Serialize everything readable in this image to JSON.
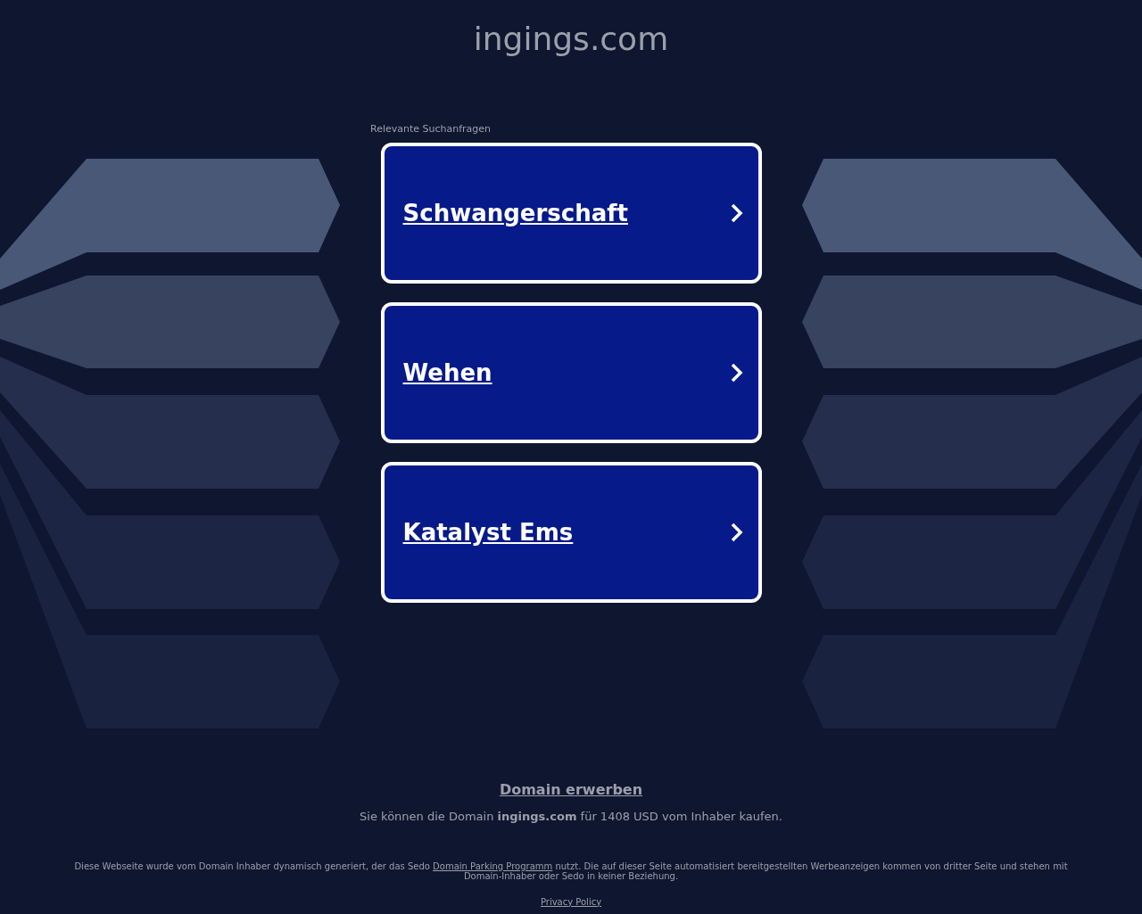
{
  "site_title": "ingings.com",
  "related_label": "Relevante Suchanfragen",
  "links": [
    {
      "label": "Schwangerschaft"
    },
    {
      "label": "Wehen"
    },
    {
      "label": "Katalyst Ems"
    }
  ],
  "buy_link": "Domain erwerben",
  "buy_text": "Sie können die Domain **ingings.com** für 1408 USD vom Inhaber kaufen.",
  "disclaimer": {
    "before": "Diese Webseite wurde vom Domain Inhaber dynamisch generiert, der das Sedo",
    "link": "Domain Parking Programm",
    "after": "nutzt. Die auf dieser Seite automatisiert bereitgestellten Werbeanzeigen kommen von dritter Seite und stehen mit Domain-Inhaber oder Sedo in keiner Beziehung."
  },
  "privacy_link": "Privacy Policy"
}
